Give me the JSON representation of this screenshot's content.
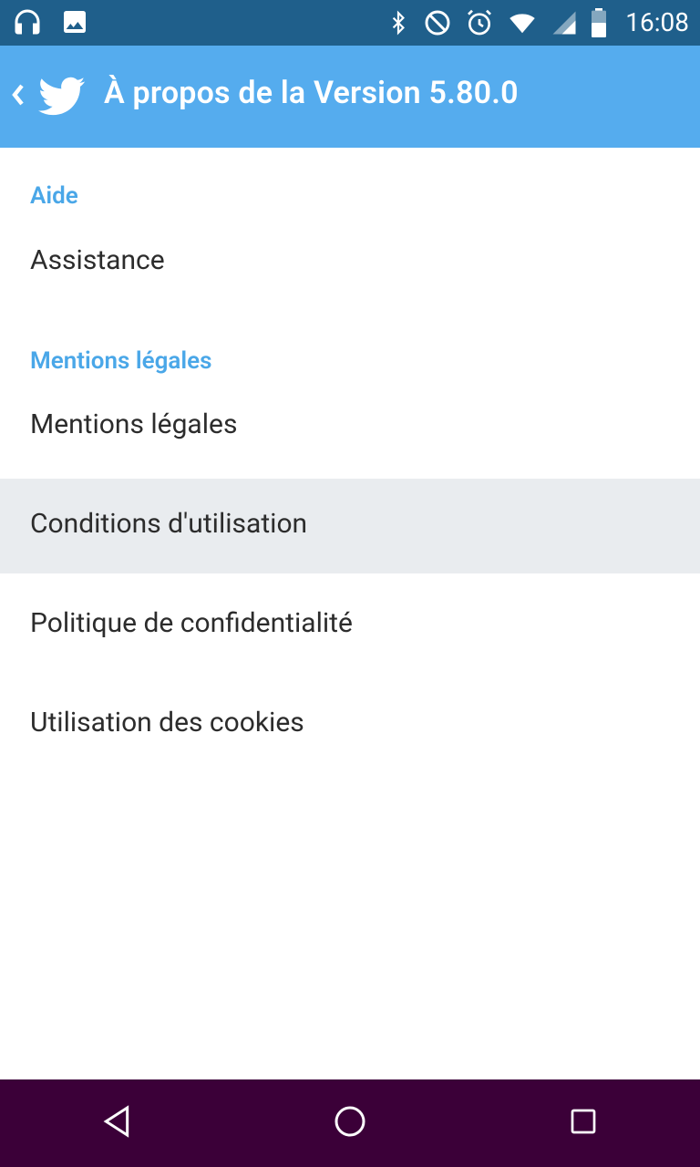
{
  "status_bar": {
    "time": "16:08",
    "left_icons": [
      "headphones-icon",
      "image-icon"
    ],
    "right_icons": [
      "bluetooth-icon",
      "do-not-disturb-icon",
      "alarm-icon",
      "wifi-icon",
      "signal-icon",
      "battery-icon"
    ]
  },
  "app_bar": {
    "title": "À propos de la Version 5.80.0",
    "back_icon": "chevron-left-icon",
    "logo": "twitter-bird-icon",
    "background": "#55acee"
  },
  "sections": {
    "aide": {
      "header": "Aide",
      "items": [
        "Assistance"
      ]
    },
    "mentions": {
      "header": "Mentions légales",
      "items": [
        "Mentions légales",
        "Conditions d'utilisation",
        "Politique de confidentialité",
        "Utilisation des cookies"
      ]
    }
  },
  "nav_bar": {
    "buttons": [
      "back-nav-icon",
      "home-nav-icon",
      "recents-nav-icon"
    ],
    "background": "#3b0038"
  },
  "colors": {
    "status_bar": "#1f5f8b",
    "accent": "#4aa7e8",
    "pressed_row": "#e9ecef"
  }
}
